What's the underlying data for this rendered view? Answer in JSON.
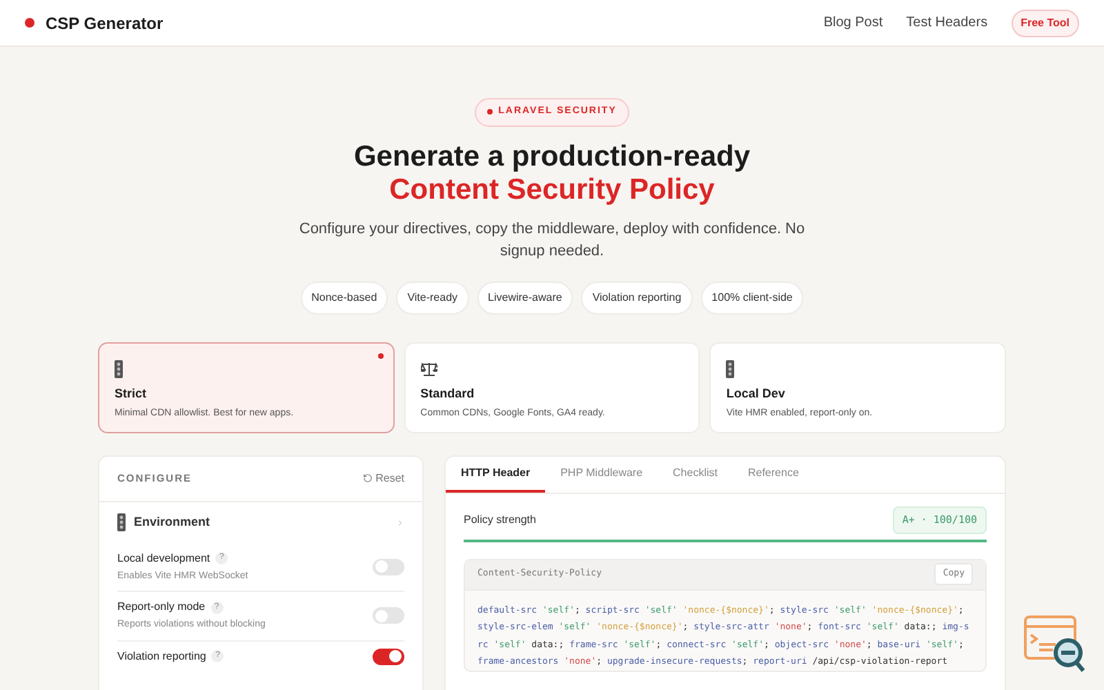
{
  "nav": {
    "brand": "CSP Generator",
    "links": [
      "Blog Post",
      "Test Headers"
    ],
    "badge": "Free Tool"
  },
  "hero": {
    "eyebrow": "LARAVEL SECURITY",
    "title": "Generate a production-ready",
    "title_accent": "Content Security Policy",
    "subtitle": "Configure your directives, copy the middleware, deploy with confidence. No signup needed.",
    "chips": [
      "Nonce-based",
      "Vite-ready",
      "Livewire-aware",
      "Violation reporting",
      "100% client-side"
    ]
  },
  "presets": [
    {
      "kind": "light",
      "title": "Strict",
      "description": "Minimal CDN allowlist. Best for new apps.",
      "selected": true
    },
    {
      "kind": "scale",
      "title": "Standard",
      "description": "Common CDNs, Google Fonts, GA4 ready.",
      "selected": false
    },
    {
      "kind": "light",
      "title": "Local Dev",
      "description": "Vite HMR enabled, report-only on.",
      "selected": false
    }
  ],
  "configure": {
    "title": "CONFIGURE",
    "reset": "Reset",
    "section": "Environment",
    "options": [
      {
        "label": "Local development",
        "help": "?",
        "hint": "Enables Vite HMR WebSocket",
        "on": false
      },
      {
        "label": "Report-only mode",
        "help": "?",
        "hint": "Reports violations without blocking",
        "on": false
      },
      {
        "label": "Violation reporting",
        "help": "?",
        "on": true
      }
    ]
  },
  "output": {
    "tabs": [
      {
        "label": "HTTP Header",
        "selected": true
      },
      {
        "label": "PHP Middleware",
        "selected": false
      },
      {
        "label": "Checklist",
        "selected": false
      },
      {
        "label": "Reference",
        "selected": false
      }
    ],
    "strength_label": "Policy strength",
    "score": "A+ · 100/100",
    "level": 1,
    "code_title": "Content-Security-Policy",
    "copy": "Copy",
    "tokens": [
      {
        "text": "default-src",
        "kind": "directive"
      },
      {
        "text": "'self'",
        "kind": "self"
      },
      {
        "text": ";",
        "kind": "punct"
      },
      {
        "text": "script-src",
        "kind": "directive"
      },
      {
        "text": "'self'",
        "kind": "self"
      },
      {
        "text": "'nonce-{$nonce}'",
        "kind": "nonce"
      },
      {
        "text": ";",
        "kind": "punct"
      },
      {
        "text": "style-src",
        "kind": "directive"
      },
      {
        "text": "'self'",
        "kind": "self"
      },
      {
        "text": "'nonce-{$nonce}'",
        "kind": "nonce"
      },
      {
        "text": ";",
        "kind": "punct"
      },
      {
        "text": "style-src-elem",
        "kind": "directive"
      },
      {
        "text": "'self'",
        "kind": "self"
      },
      {
        "text": "'nonce-{$nonce}'",
        "kind": "nonce"
      },
      {
        "text": ";",
        "kind": "punct"
      },
      {
        "text": "style-src-attr",
        "kind": "directive"
      },
      {
        "text": "'none'",
        "kind": "none"
      },
      {
        "text": ";",
        "kind": "punct"
      },
      {
        "text": "font-src",
        "kind": "directive"
      },
      {
        "text": "'self'",
        "kind": "self"
      },
      {
        "text": "data:",
        "kind": "plain"
      },
      {
        "text": ";",
        "kind": "punct"
      },
      {
        "text": "img-src",
        "kind": "directive"
      },
      {
        "text": "'self'",
        "kind": "self"
      },
      {
        "text": "data:",
        "kind": "plain"
      },
      {
        "text": ";",
        "kind": "punct"
      },
      {
        "text": "frame-src",
        "kind": "directive"
      },
      {
        "text": "'self'",
        "kind": "self"
      },
      {
        "text": ";",
        "kind": "punct"
      },
      {
        "text": "connect-src",
        "kind": "directive"
      },
      {
        "text": "'self'",
        "kind": "self"
      },
      {
        "text": ";",
        "kind": "punct"
      },
      {
        "text": "object-src",
        "kind": "directive"
      },
      {
        "text": "'none'",
        "kind": "none"
      },
      {
        "text": ";",
        "kind": "punct"
      },
      {
        "text": "base-uri",
        "kind": "directive"
      },
      {
        "text": "'self'",
        "kind": "self"
      },
      {
        "text": ";",
        "kind": "punct"
      },
      {
        "text": "frame-ancestors",
        "kind": "directive"
      },
      {
        "text": "'none'",
        "kind": "none"
      },
      {
        "text": ";",
        "kind": "punct"
      },
      {
        "text": "upgrade-insecure-requests",
        "kind": "directive"
      },
      {
        "text": ";",
        "kind": "punct"
      },
      {
        "text": "report-uri",
        "kind": "directive"
      },
      {
        "text": "/api/csp-violation-report",
        "kind": "plain"
      }
    ]
  }
}
